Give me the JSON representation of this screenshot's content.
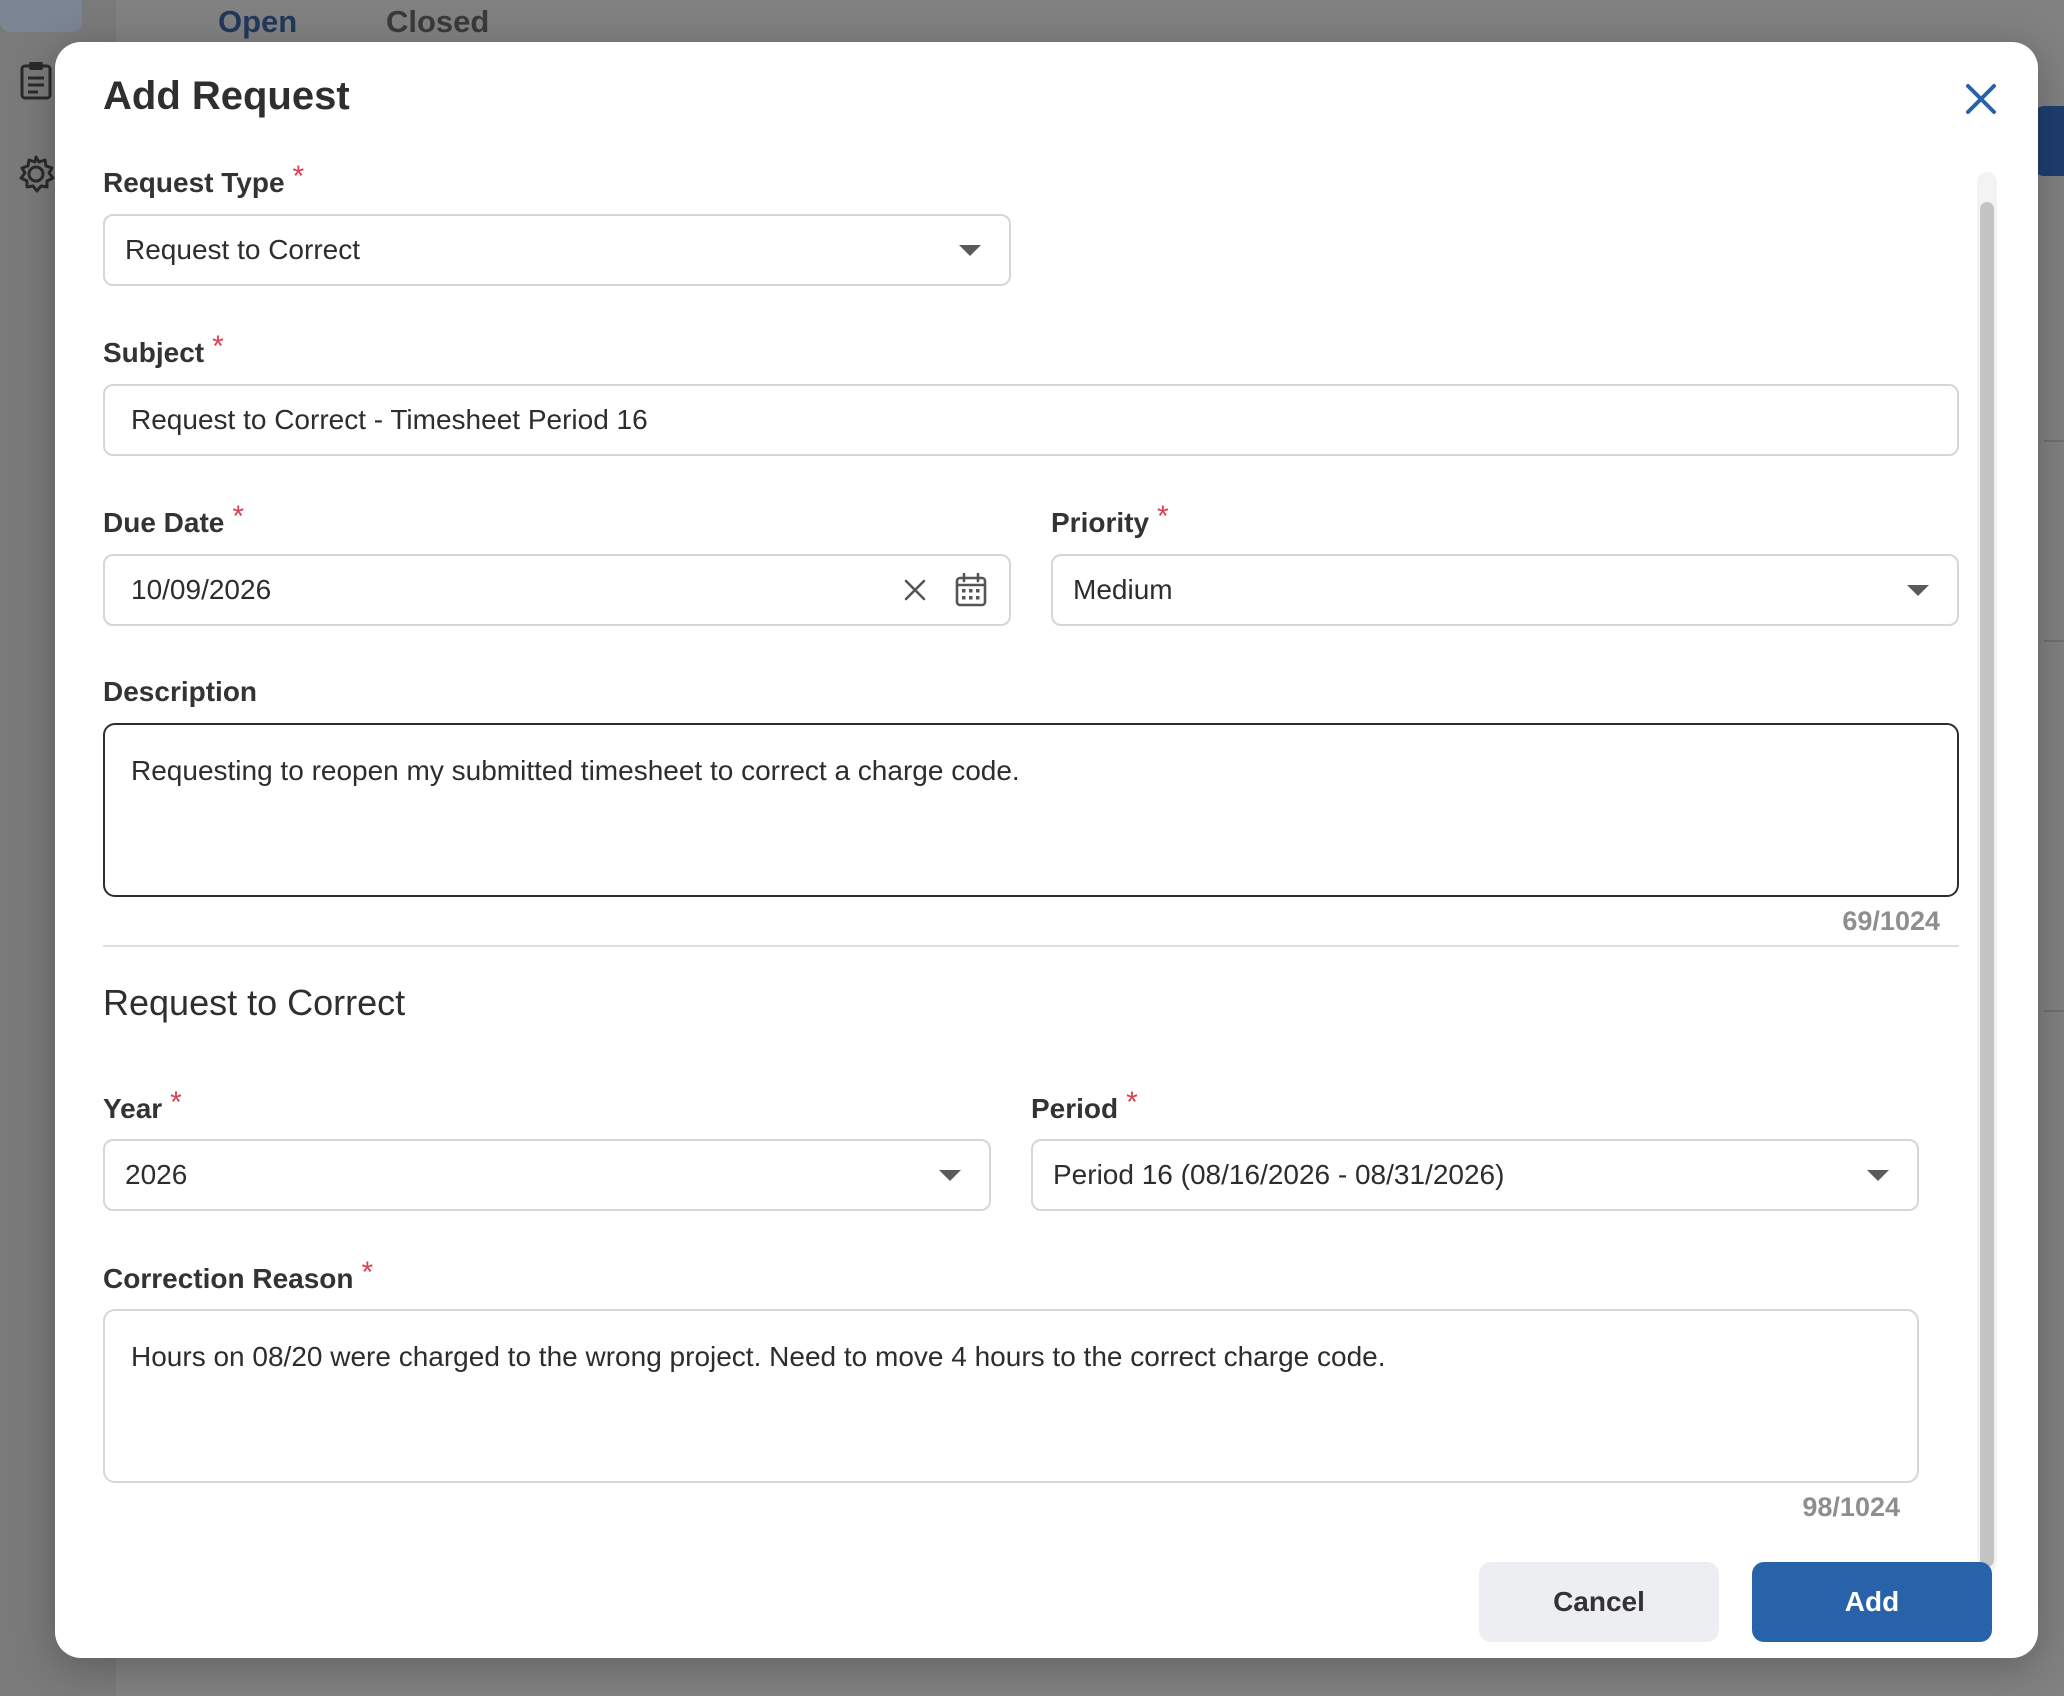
{
  "background": {
    "tabs": [
      {
        "label": "Open"
      },
      {
        "label": "Closed"
      }
    ]
  },
  "modal": {
    "title": "Add Request",
    "close_icon": "close-icon",
    "required_marker": "*",
    "request_type": {
      "label": "Request Type",
      "value": "Request to Correct"
    },
    "subject": {
      "label": "Subject",
      "value": "Request to Correct - Timesheet Period 16"
    },
    "due_date": {
      "label": "Due Date",
      "value": "10/09/2026"
    },
    "priority": {
      "label": "Priority",
      "value": "Medium"
    },
    "description": {
      "label": "Description",
      "value": "Requesting to reopen my submitted timesheet to correct a charge code.",
      "counter": "69/1024"
    },
    "section_title": "Request to Correct",
    "year": {
      "label": "Year",
      "value": "2026"
    },
    "period": {
      "label": "Period",
      "value": "Period 16 (08/16/2026 - 08/31/2026)"
    },
    "correction_reason": {
      "label": "Correction Reason",
      "value": "Hours on 08/20 were charged to the wrong project. Need to move 4 hours to the correct charge code.",
      "counter": "98/1024"
    },
    "buttons": {
      "cancel": "Cancel",
      "add": "Add"
    }
  },
  "colors": {
    "primary": "#2862a8",
    "required": "#d94052",
    "overlay": "#808080"
  }
}
